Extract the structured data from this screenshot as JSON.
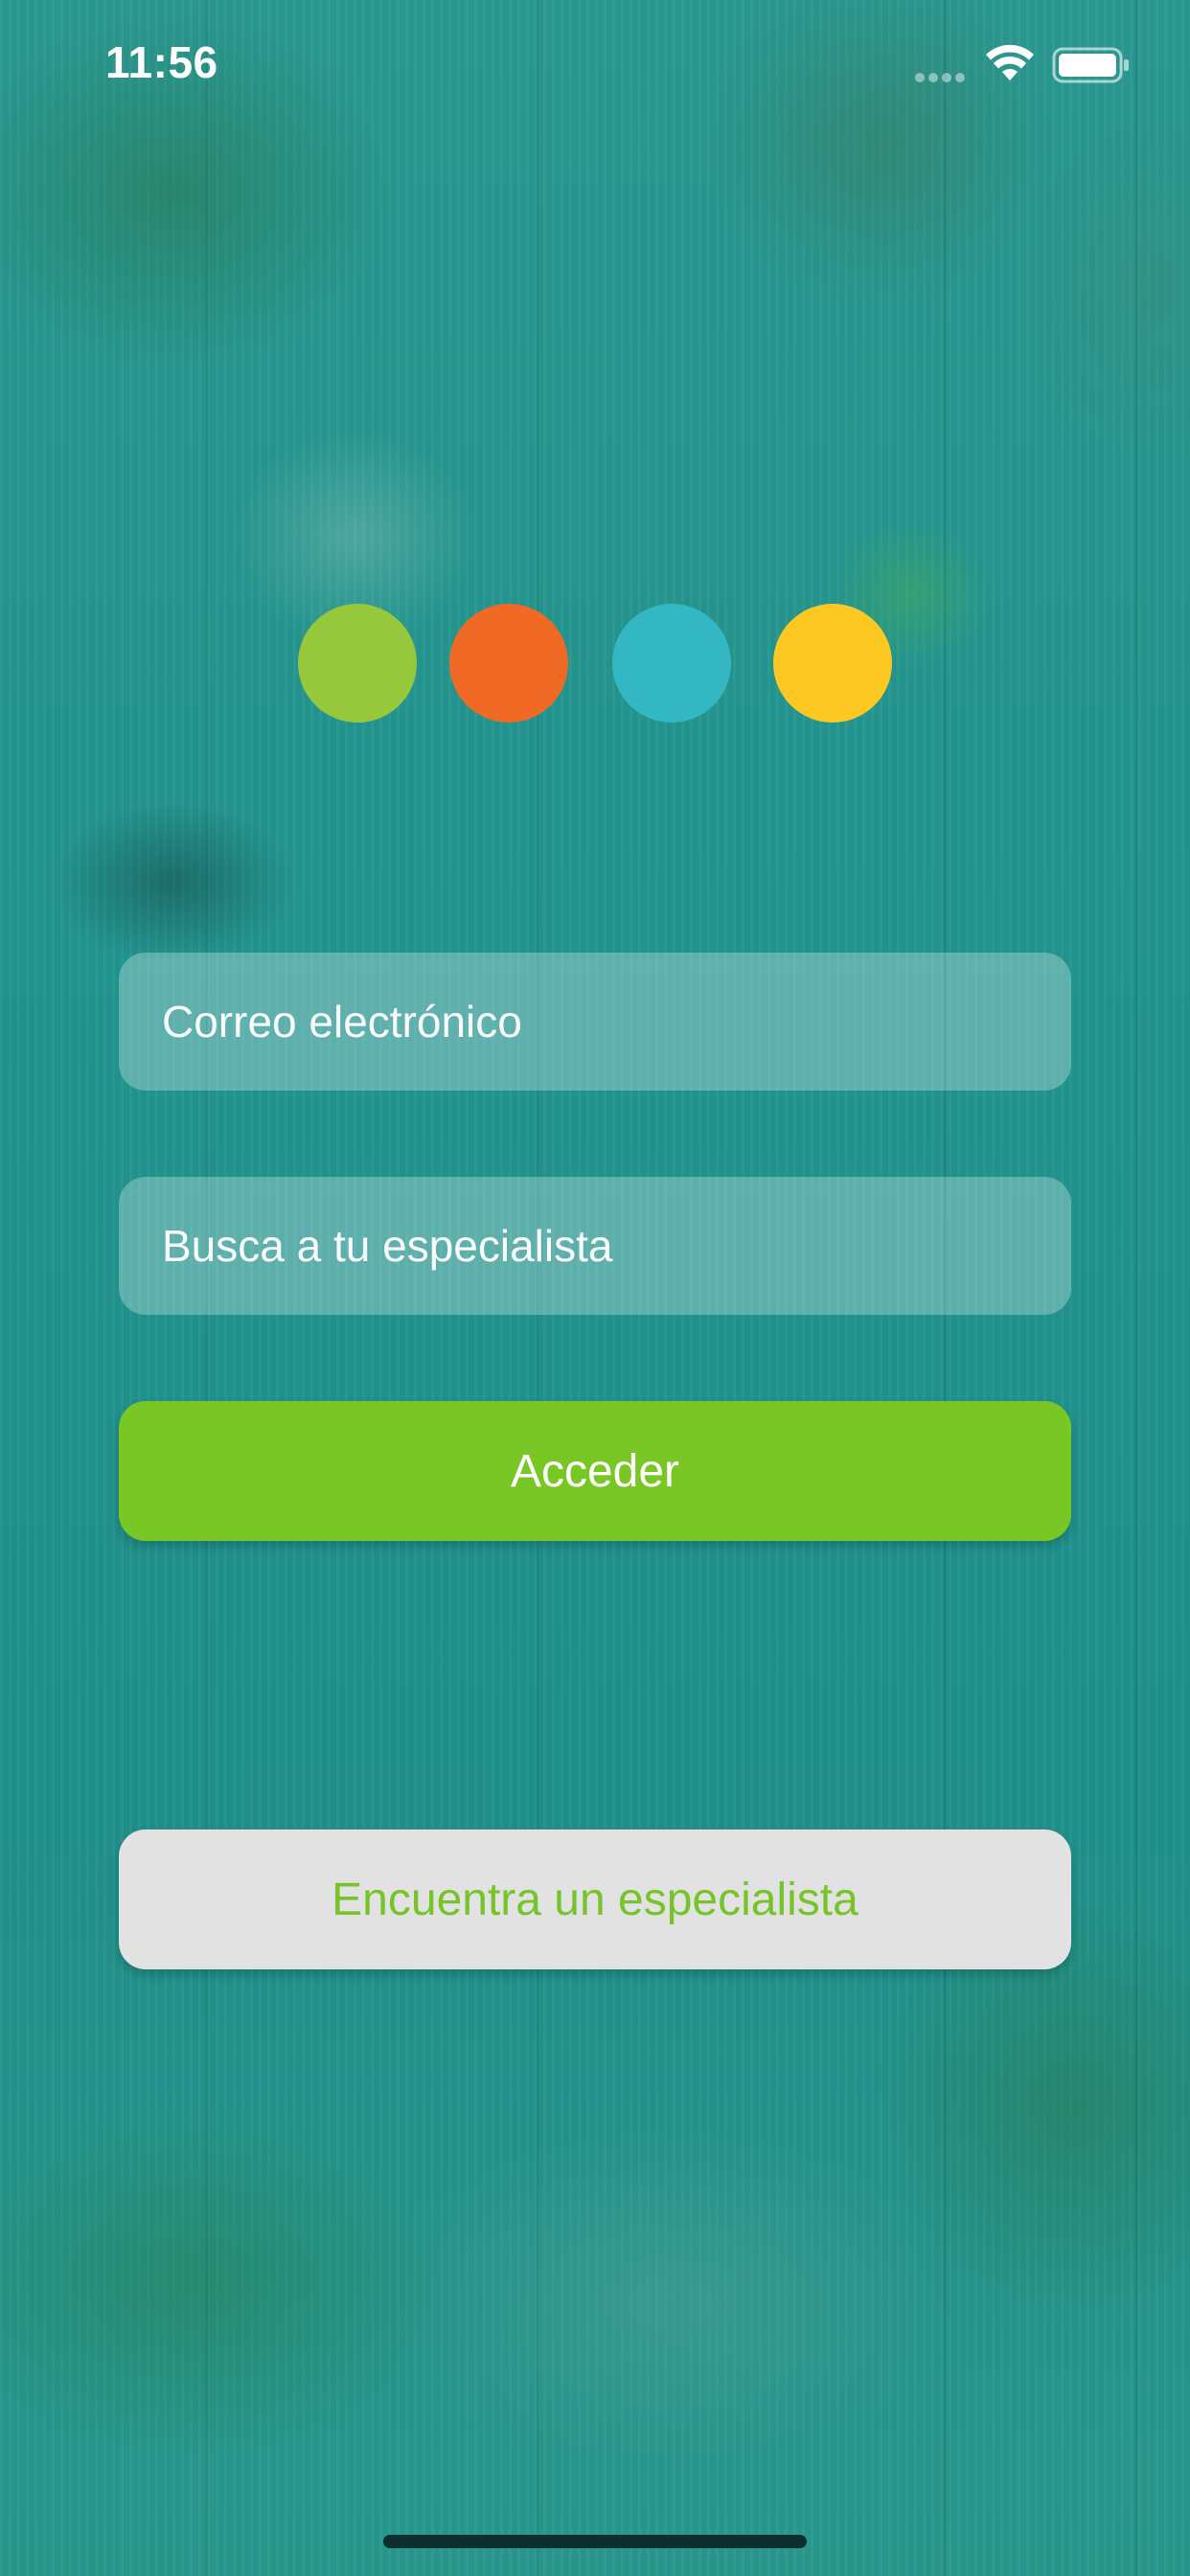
{
  "status_bar": {
    "time": "11:56"
  },
  "logo": {
    "dots": [
      {
        "color": "#97c83c"
      },
      {
        "color": "#f06a26"
      },
      {
        "color": "#33b8c3"
      },
      {
        "color": "#fdc822"
      }
    ]
  },
  "login_form": {
    "email_placeholder": "Correo electrónico",
    "specialist_placeholder": "Busca a tu especialista",
    "submit_label": "Acceder"
  },
  "find_specialist_button": {
    "label": "Encuentra un especialista"
  },
  "colors": {
    "primary_button": "#79c725",
    "secondary_button": "#e2e2e2",
    "secondary_text": "#76c42a",
    "background_tint": "#21928c"
  }
}
